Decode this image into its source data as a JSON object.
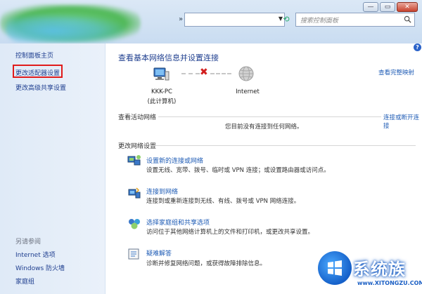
{
  "window": {
    "search_placeholder": "搜索控制面板",
    "controls": {
      "minimize": "—",
      "maximize": "▭",
      "close": "✕"
    }
  },
  "sidebar": {
    "home": "控制面板主页",
    "adapter_settings": "更改适配器设置",
    "advanced_sharing": "更改高级共享设置",
    "see_also_title": "另请参阅",
    "see_also": [
      "Internet 选项",
      "Windows 防火墙",
      "家庭组"
    ]
  },
  "main": {
    "title": "查看基本网络信息并设置连接",
    "full_map": "查看完整映射",
    "computer_name": "KKK-PC",
    "computer_sub": "(此计算机)",
    "internet": "Internet",
    "active_title": "查看活动网络",
    "connect_link": "连接或断开连接",
    "not_connected": "您目前没有连接到任何网络。",
    "change_title": "更改网络设置",
    "tasks": [
      {
        "title": "设置新的连接或网络",
        "desc": "设置无线、宽带、拨号、临时或 VPN 连接；或设置路由器或访问点。",
        "icon": "network-setup-icon"
      },
      {
        "title": "连接到网络",
        "desc": "连接到或重新连接到无线、有线、拨号或 VPN 网络连接。",
        "icon": "connect-network-icon"
      },
      {
        "title": "选择家庭组和共享选项",
        "desc": "访问位于其他网络计算机上的文件和打印机，或更改共享设置。",
        "icon": "homegroup-icon"
      },
      {
        "title": "疑难解答",
        "desc": "诊断并修复网络问题，或获得故障排除信息。",
        "icon": "troubleshoot-icon"
      }
    ]
  },
  "watermark": {
    "name": "系统族",
    "url": "www.XITONGZU.COM"
  },
  "colors": {
    "highlight": "#e01b1b",
    "link": "#1e5bb5",
    "sidebar": "#dfeaf7"
  }
}
